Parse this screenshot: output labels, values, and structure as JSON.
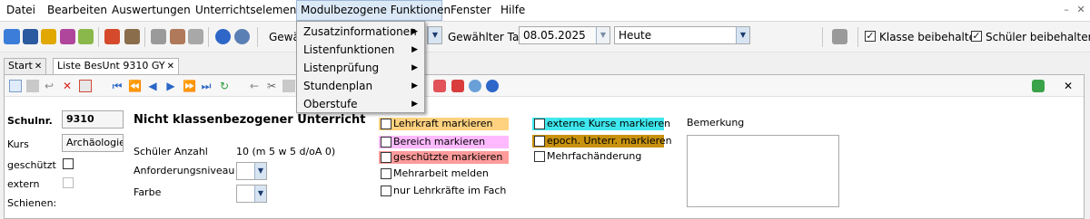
{
  "menubar": {
    "items": [
      "Datei",
      "Bearbeiten",
      "Auswertungen",
      "Unterrichtselement",
      "Modulbezogene Funktionen",
      "Fenster",
      "Hilfe"
    ],
    "minimize": "–",
    "close": "✕"
  },
  "dropdown": {
    "items": [
      "Zusatzinformationen",
      "Listenfunktionen",
      "Listenprüfung",
      "Stundenplan",
      "Oberstufe"
    ]
  },
  "toolbar": {
    "gew_label_cut": "Gewä",
    "day_label": "Gewählter Tag",
    "date_value": "08.05.2025",
    "today_value": "Heute",
    "keep_class_label": "Klasse beibehalten",
    "keep_student_label": "Schüler beibehalten",
    "keep_class_checked": "✓",
    "keep_student_checked": "✓"
  },
  "tabs": [
    {
      "label": "Start",
      "close": "✕"
    },
    {
      "label": "Liste BesUnt 9310 GY",
      "close": "✕"
    }
  ],
  "panel_close": "✕",
  "form": {
    "schulnr_label": "Schulnr.",
    "schulnr_value": "9310",
    "kurs_label": "Kurs",
    "kurs_value": "Archäologie",
    "geschuetzt_label": "geschützt",
    "extern_label": "extern",
    "schienen_label": "Schienen:",
    "heading": "Nicht klassenbezogener Unterricht",
    "schueler_anzahl_label": "Schüler Anzahl",
    "schueler_anzahl_value": "10 (m 5 w 5 d/oA 0)",
    "anforderungsniveau_label": "Anforderungsniveau",
    "farbe_label": "Farbe",
    "bemerkung_label": "Bemerkung"
  },
  "markers_left": [
    {
      "label": "Lehrkraft markieren",
      "color": "#ffd27f"
    },
    {
      "label": "Bereich markieren",
      "color": "#ffb9ff"
    },
    {
      "label": "geschützte markieren",
      "color": "#ff9b9b"
    },
    {
      "label": "Mehrarbeit melden",
      "color": ""
    },
    {
      "label": "nur Lehrkräfte im Fach",
      "color": ""
    }
  ],
  "markers_right": [
    {
      "label": "externe Kurse markieren",
      "color": "#3ee8ee"
    },
    {
      "label": "epoch. Unterr. markieren",
      "color": "#c8920e"
    },
    {
      "label": "Mehrfachänderung",
      "color": ""
    }
  ],
  "nav_icons": [
    "⏮",
    "⏪",
    "◀",
    "▶",
    "⏩",
    "⏭"
  ]
}
